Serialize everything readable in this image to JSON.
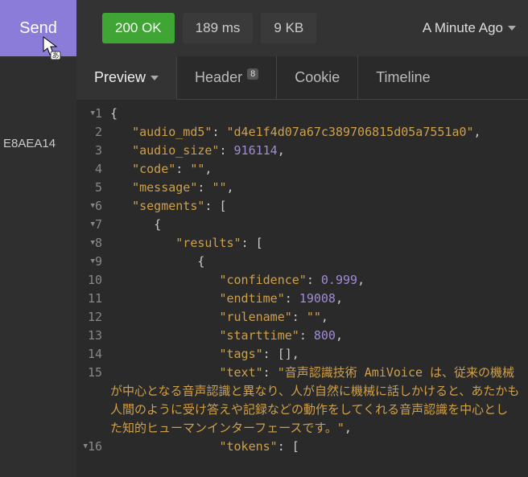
{
  "topbar": {
    "send_label": "Send",
    "status": "200 OK",
    "time": "189 ms",
    "size": "9 KB",
    "ago": "A Minute Ago"
  },
  "sidebar": {
    "text": "E8AEA14"
  },
  "tabs": {
    "preview": "Preview",
    "header": "Header",
    "header_badge": "8",
    "cookie": "Cookie",
    "timeline": "Timeline"
  },
  "code": {
    "lines": [
      {
        "num": "1",
        "fold": true,
        "tokens": [
          [
            "p",
            "{"
          ]
        ]
      },
      {
        "num": "2",
        "fold": false,
        "indent": "   ",
        "tokens": [
          [
            "k",
            "\"audio_md5\""
          ],
          [
            "p",
            ": "
          ],
          [
            "s",
            "\"d4e1f4d07a67c389706815d05a7551a0\""
          ],
          [
            "p",
            ","
          ]
        ]
      },
      {
        "num": "3",
        "fold": false,
        "indent": "   ",
        "tokens": [
          [
            "k",
            "\"audio_size\""
          ],
          [
            "p",
            ": "
          ],
          [
            "n",
            "916114"
          ],
          [
            "p",
            ","
          ]
        ]
      },
      {
        "num": "4",
        "fold": false,
        "indent": "   ",
        "tokens": [
          [
            "k",
            "\"code\""
          ],
          [
            "p",
            ": "
          ],
          [
            "s",
            "\"\""
          ],
          [
            "p",
            ","
          ]
        ]
      },
      {
        "num": "5",
        "fold": false,
        "indent": "   ",
        "tokens": [
          [
            "k",
            "\"message\""
          ],
          [
            "p",
            ": "
          ],
          [
            "s",
            "\"\""
          ],
          [
            "p",
            ","
          ]
        ]
      },
      {
        "num": "6",
        "fold": true,
        "indent": "   ",
        "tokens": [
          [
            "k",
            "\"segments\""
          ],
          [
            "p",
            ": ["
          ]
        ]
      },
      {
        "num": "7",
        "fold": true,
        "indent": "      ",
        "tokens": [
          [
            "p",
            "{"
          ]
        ]
      },
      {
        "num": "8",
        "fold": true,
        "indent": "         ",
        "tokens": [
          [
            "k",
            "\"results\""
          ],
          [
            "p",
            ": ["
          ]
        ]
      },
      {
        "num": "9",
        "fold": true,
        "indent": "            ",
        "tokens": [
          [
            "p",
            "{"
          ]
        ]
      },
      {
        "num": "10",
        "fold": false,
        "indent": "               ",
        "tokens": [
          [
            "k",
            "\"confidence\""
          ],
          [
            "p",
            ": "
          ],
          [
            "n",
            "0.999"
          ],
          [
            "p",
            ","
          ]
        ]
      },
      {
        "num": "11",
        "fold": false,
        "indent": "               ",
        "tokens": [
          [
            "k",
            "\"endtime\""
          ],
          [
            "p",
            ": "
          ],
          [
            "n",
            "19008"
          ],
          [
            "p",
            ","
          ]
        ]
      },
      {
        "num": "12",
        "fold": false,
        "indent": "               ",
        "tokens": [
          [
            "k",
            "\"rulename\""
          ],
          [
            "p",
            ": "
          ],
          [
            "s",
            "\"\""
          ],
          [
            "p",
            ","
          ]
        ]
      },
      {
        "num": "13",
        "fold": false,
        "indent": "               ",
        "tokens": [
          [
            "k",
            "\"starttime\""
          ],
          [
            "p",
            ": "
          ],
          [
            "n",
            "800"
          ],
          [
            "p",
            ","
          ]
        ]
      },
      {
        "num": "14",
        "fold": false,
        "indent": "               ",
        "tokens": [
          [
            "k",
            "\"tags\""
          ],
          [
            "p",
            ": [],"
          ]
        ]
      },
      {
        "num": "15",
        "fold": false,
        "indent": "               ",
        "tokens": [
          [
            "k",
            "\"text\""
          ],
          [
            "p",
            ": "
          ],
          [
            "s",
            "\"音声認識技術 AmiVoice は、従来の機械が中心となる音声認識と異なり、人が自然に機械に話しかけると、あたかも人間のように受け答えや記録などの動作をしてくれる音声認識を中心とした知的ヒューマンインターフェースです。\""
          ],
          [
            "p",
            ","
          ]
        ]
      },
      {
        "num": "16",
        "fold": true,
        "indent": "               ",
        "tokens": [
          [
            "k",
            "\"tokens\""
          ],
          [
            "p",
            ": ["
          ]
        ]
      }
    ]
  }
}
